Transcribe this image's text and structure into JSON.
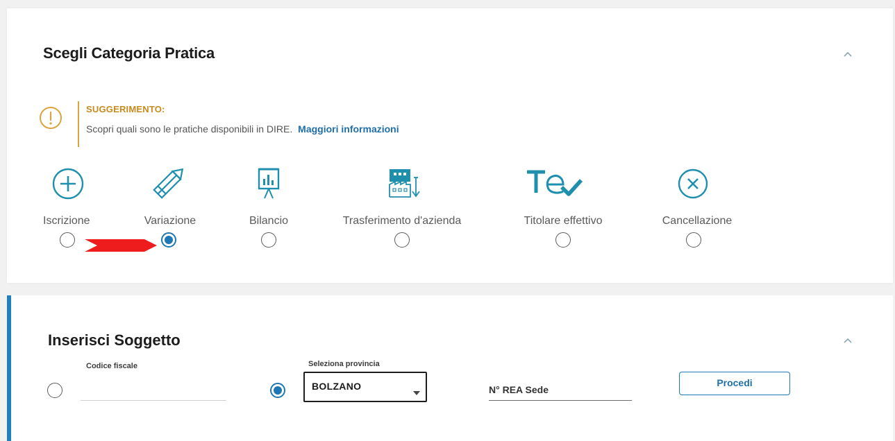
{
  "category_section": {
    "title": "Scegli Categoria Pratica",
    "hint": {
      "title": "SUGGERIMENTO:",
      "text": "Scopri quali sono le pratiche disponibili in DIRE.",
      "link": "Maggiori informazioni"
    },
    "categories": [
      {
        "label": "Iscrizione",
        "icon": "plus-circle-icon",
        "selected": false
      },
      {
        "label": "Variazione",
        "icon": "pencil-icon",
        "selected": true
      },
      {
        "label": "Bilancio",
        "icon": "presentation-chart-icon",
        "selected": false
      },
      {
        "label": "Trasferimento d'azienda",
        "icon": "factory-transfer-icon",
        "selected": false
      },
      {
        "label": "Titolare effettivo",
        "icon": "te-check-icon",
        "selected": false
      },
      {
        "label": "Cancellazione",
        "icon": "x-circle-icon",
        "selected": false
      }
    ],
    "annotation": "red-arrow-icon"
  },
  "subject_section": {
    "title": "Inserisci Soggetto",
    "codice_fiscale_label": "Codice fiscale",
    "codice_fiscale_value": "",
    "codice_fiscale_selected": false,
    "provincia_label": "Seleziona provincia",
    "provincia_value": "BOLZANO",
    "provincia_selected": true,
    "rea_placeholder": "N° REA Sede",
    "proceed_label": "Procedi"
  },
  "colors": {
    "accent": "#1f78b4",
    "hint": "#d9a53c",
    "link": "#1f6fa8",
    "arrow": "#ee1c1c",
    "teal": "#1f8fae"
  }
}
